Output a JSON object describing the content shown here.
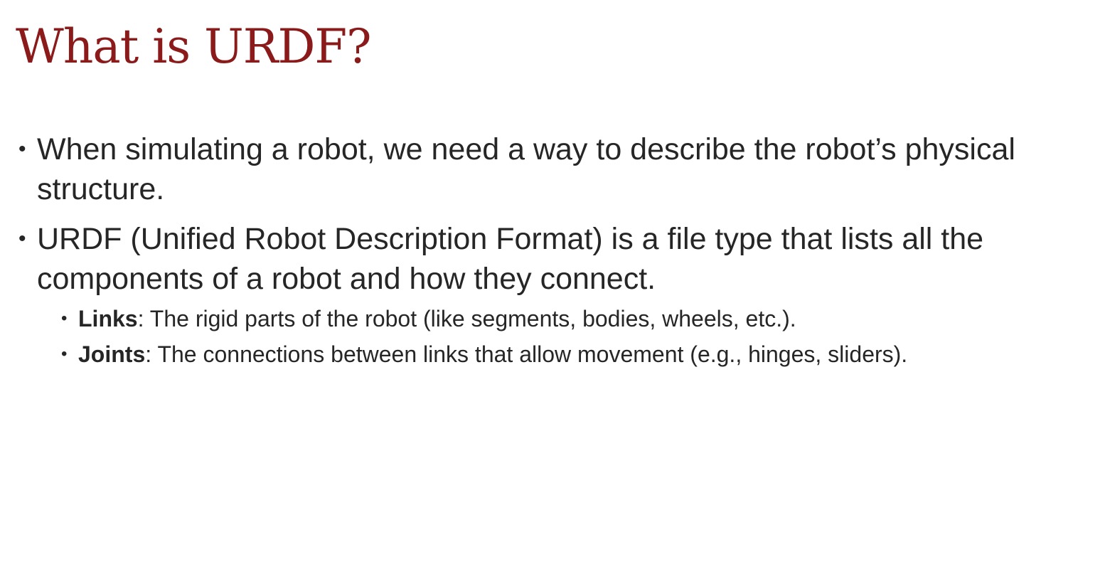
{
  "slide": {
    "title": "What is URDF?",
    "bullets": [
      {
        "text": "When simulating a robot, we need a way to describe the robot’s physical structure."
      },
      {
        "text": "URDF (Unified Robot Description Format) is a file type that lists all the components of a robot and how they connect."
      }
    ],
    "sub_bullets": [
      {
        "term": "Links",
        "text": ": The rigid parts of the robot (like segments, bodies, wheels, etc.)."
      },
      {
        "term": "Joints",
        "text": ": The connections between links that allow movement (e.g., hinges, sliders)."
      }
    ],
    "colors": {
      "title": "#8b1a1a",
      "body_text": "#262626",
      "background": "#ffffff"
    }
  }
}
